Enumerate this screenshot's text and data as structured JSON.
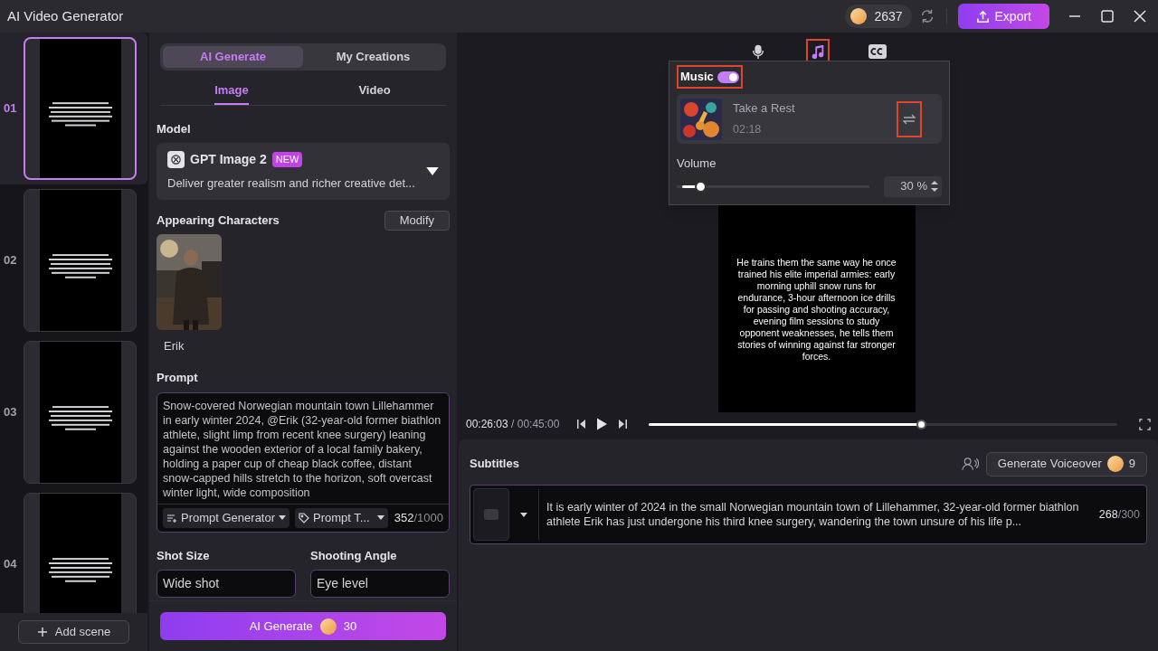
{
  "window": {
    "title": "AI Video Generator"
  },
  "header": {
    "credits": "2637",
    "export_label": "Export"
  },
  "scenes": [
    {
      "number": "01",
      "kind": "picture",
      "selected": true
    },
    {
      "number": "02",
      "kind": "picture",
      "selected": false
    },
    {
      "number": "03",
      "kind": "picture",
      "selected": false
    },
    {
      "number": "04",
      "kind": "picture",
      "selected": false
    }
  ],
  "add_scene": "Add scene",
  "mode_tabs": [
    {
      "label": "AI Generate",
      "selected": true
    },
    {
      "label": "My Creations",
      "selected": false
    }
  ],
  "type_tabs": [
    {
      "label": "Image",
      "selected": true
    },
    {
      "label": "Video",
      "selected": false
    }
  ],
  "model": {
    "heading": "Model",
    "name": "GPT Image 2",
    "badge": "NEW",
    "description": "Deliver greater realism and richer creative det..."
  },
  "characters": {
    "heading": "Appearing Characters",
    "modify": "Modify",
    "items": [
      {
        "name": "Erik",
        "kind": "picture"
      }
    ]
  },
  "prompt": {
    "heading": "Prompt",
    "value": "Snow-covered Norwegian mountain town Lillehammer in early winter 2024, @Erik (32-year-old former biathlon athlete, slight limp from recent knee surgery) leaning against the wooden exterior of a local family bakery, holding a paper cup of cheap black coffee, distant snow-capped hills stretch to the horizon, soft overcast winter light, wide composition",
    "generator": "Prompt Generator",
    "template": "Prompt T...",
    "count": "352",
    "max": "/1000"
  },
  "shot_size": {
    "label": "Shot Size",
    "value": "Wide shot"
  },
  "shooting_angle": {
    "label": "Shooting Angle",
    "value": "Eye level"
  },
  "generate": {
    "label": "AI Generate",
    "cost": "30"
  },
  "tools": [
    {
      "kind": "voice",
      "selected": false
    },
    {
      "kind": "music",
      "selected": true
    },
    {
      "kind": "captions",
      "selected": false
    }
  ],
  "music_panel": {
    "title": "Music",
    "on": true,
    "track": {
      "name": "Take a Rest",
      "duration": "02:18"
    },
    "volume_label": "Volume",
    "volume": {
      "level": 0.1
    },
    "volume_reading": "30 %"
  },
  "preview": {
    "caption": "He trains them the same way he once trained his elite imperial armies: early morning uphill snow runs for endurance, 3-hour afternoon ice drills for passing and shooting accuracy, evening film sessions to study opponent weaknesses, he tells them stories of winning against far stronger forces."
  },
  "player": {
    "current": "00:26:03",
    "total": "/ 00:45:00",
    "progress": {
      "level": 0.58
    }
  },
  "subtitles": {
    "heading": "Subtitles",
    "voiceover": "Generate Voiceover",
    "voiceover_cost": "9",
    "items": [
      {
        "text": "It is early winter of 2024 in the small Norwegian mountain town of Lillehammer, 32-year-old former biathlon athlete Erik has just undergone his third knee surgery, wandering the town unsure of his life p...",
        "count": "268",
        "max": "/300"
      }
    ]
  }
}
